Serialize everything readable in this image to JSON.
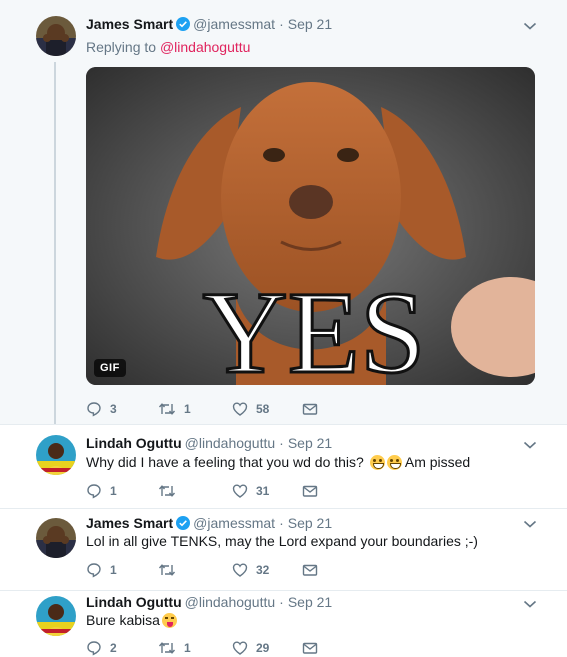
{
  "tweets": [
    {
      "name": "James Smart",
      "verified": true,
      "handle": "@jamessmat",
      "separator": "·",
      "time": "Sep 21",
      "replying_prefix": "Replying to",
      "replying_to": "@lindahoguttu",
      "media": {
        "caption": "YES",
        "badge": "GIF"
      },
      "replies": "3",
      "retweets": "1",
      "likes": "58"
    },
    {
      "name": "Lindah Oguttu",
      "verified": false,
      "handle": "@lindahoguttu",
      "separator": "·",
      "time": "Sep 21",
      "text": "Why did I have a feeling that you wd do this?",
      "text_after": "Am pissed",
      "emojis": [
        "grinning-face-icon",
        "grinning-face-icon"
      ],
      "replies": "1",
      "retweets": "",
      "likes": "31"
    },
    {
      "name": "James Smart",
      "verified": true,
      "handle": "@jamessmat",
      "separator": "·",
      "time": "Sep 21",
      "text": "Lol in all give TENKS, may the Lord expand your boundaries ;-)",
      "replies": "1",
      "retweets": "",
      "likes": "32"
    },
    {
      "name": "Lindah Oguttu",
      "verified": false,
      "handle": "@lindahoguttu",
      "separator": "·",
      "time": "Sep 21",
      "text": "Bure kabisa",
      "emojis": [
        "tongue-face-icon"
      ],
      "replies": "2",
      "retweets": "1",
      "likes": "29"
    }
  ],
  "colors": {
    "link": "#e0245e",
    "muted": "#657786",
    "verified": "#1da1f2",
    "focus_background": "#f5f8fa"
  }
}
